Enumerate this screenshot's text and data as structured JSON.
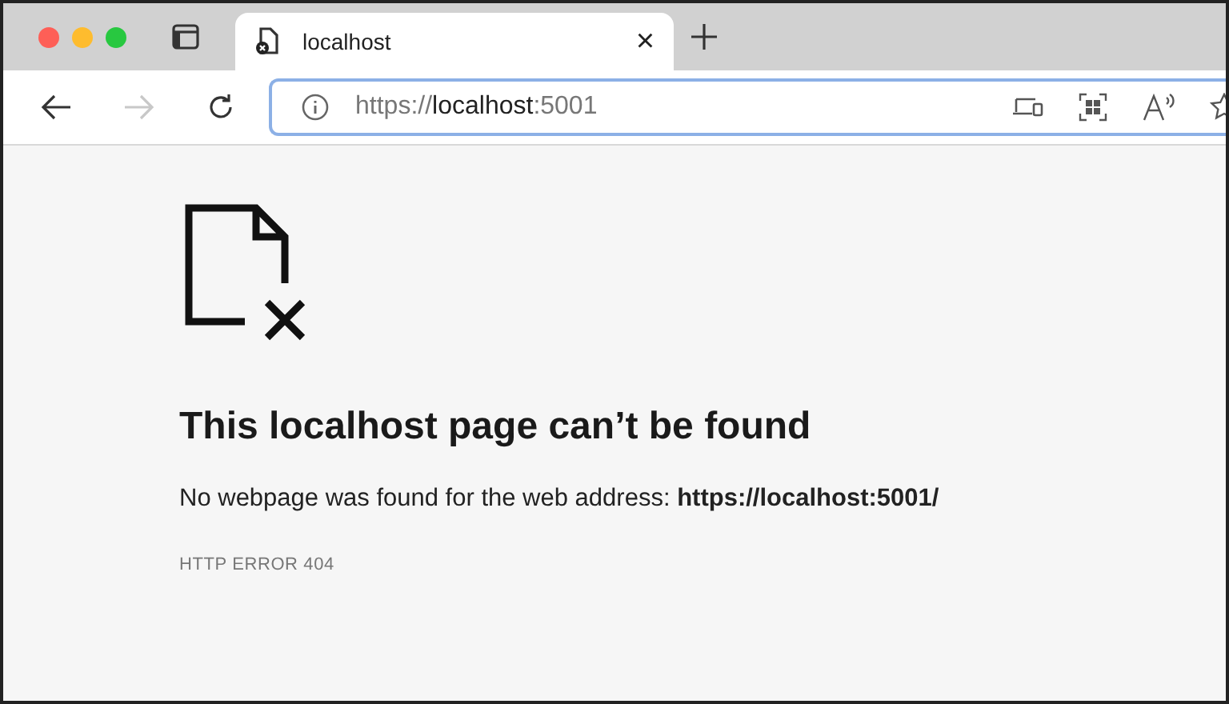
{
  "tab": {
    "title": "localhost",
    "close": "×"
  },
  "address_bar": {
    "scheme": "https://",
    "host": "localhost",
    "port": ":5001"
  },
  "navigation": {
    "forward_disabled": true
  },
  "error": {
    "heading": "This localhost page can’t be found",
    "description": "No webpage was found for the web address: **https://localhost:5001/**",
    "code": "HTTP ERROR 404"
  }
}
